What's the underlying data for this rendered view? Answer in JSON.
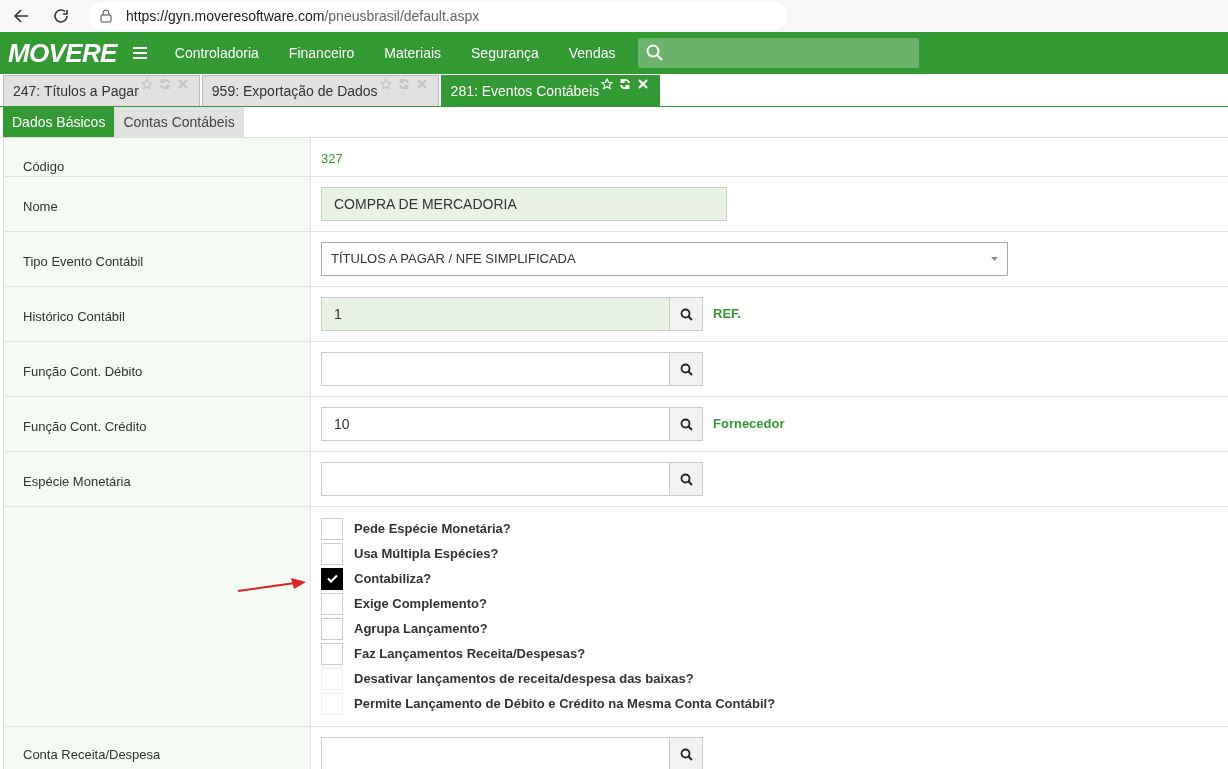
{
  "browser": {
    "url_host": "https://gyn.moveresoftware.com",
    "url_path": "/pneusbrasil/default.aspx"
  },
  "navbar": {
    "logo": "MOVERE",
    "menu": [
      "Controladoria",
      "Financeiro",
      "Materiais",
      "Segurança",
      "Vendas"
    ]
  },
  "tabs": [
    {
      "label": "247: Títulos a Pagar",
      "selected": false
    },
    {
      "label": "959: Exportação de Dados",
      "selected": false
    },
    {
      "label": "281: Eventos Contábeis",
      "selected": true
    }
  ],
  "subtabs": [
    {
      "label": "Dados Básicos",
      "selected": true
    },
    {
      "label": "Contas Contábeis",
      "selected": false
    }
  ],
  "fields": [
    {
      "kind": "static",
      "label": "Código",
      "value": "327"
    },
    {
      "kind": "text",
      "label": "Nome",
      "value": "COMPRA DE MERCADORIA"
    },
    {
      "kind": "select",
      "label": "Tipo Evento Contábil",
      "value": "TÍTULOS A PAGAR / NFE SIMPLIFICADA"
    },
    {
      "kind": "lookup",
      "label": "Histórico Contábil",
      "value": "1",
      "highlighted": true,
      "ref": "REF."
    },
    {
      "kind": "lookup",
      "label": "Função Cont. Débito",
      "highlighted": false
    },
    {
      "kind": "lookup",
      "label": "Função Cont. Crédito",
      "value": "10",
      "highlighted": false,
      "ref": "Fornecedor"
    },
    {
      "kind": "lookup",
      "label": "Espécie Monetária",
      "highlighted": false
    },
    {
      "kind": "checks",
      "options": [
        {
          "label": "Pede Espécie Monetária?",
          "checked": false,
          "disabled": false
        },
        {
          "label": "Usa Múltipla Espécies?",
          "checked": false,
          "disabled": false
        },
        {
          "label": "Contabiliza?",
          "checked": true,
          "disabled": false
        },
        {
          "label": "Exige Complemento?",
          "checked": false,
          "disabled": false
        },
        {
          "label": "Agrupa Lançamento?",
          "checked": false,
          "disabled": false
        },
        {
          "label": "Faz Lançamentos Receita/Despesas?",
          "checked": false,
          "disabled": false
        },
        {
          "label": "Desativar lançamentos de receita/despesa das baixas?",
          "checked": false,
          "disabled": true
        },
        {
          "label": "Permite Lançamento de Débito e Crédito na Mesma Conta Contábil?",
          "checked": false,
          "disabled": true
        }
      ]
    },
    {
      "kind": "lookup",
      "label": "Conta Receita/Despesa",
      "highlighted": false
    }
  ]
}
